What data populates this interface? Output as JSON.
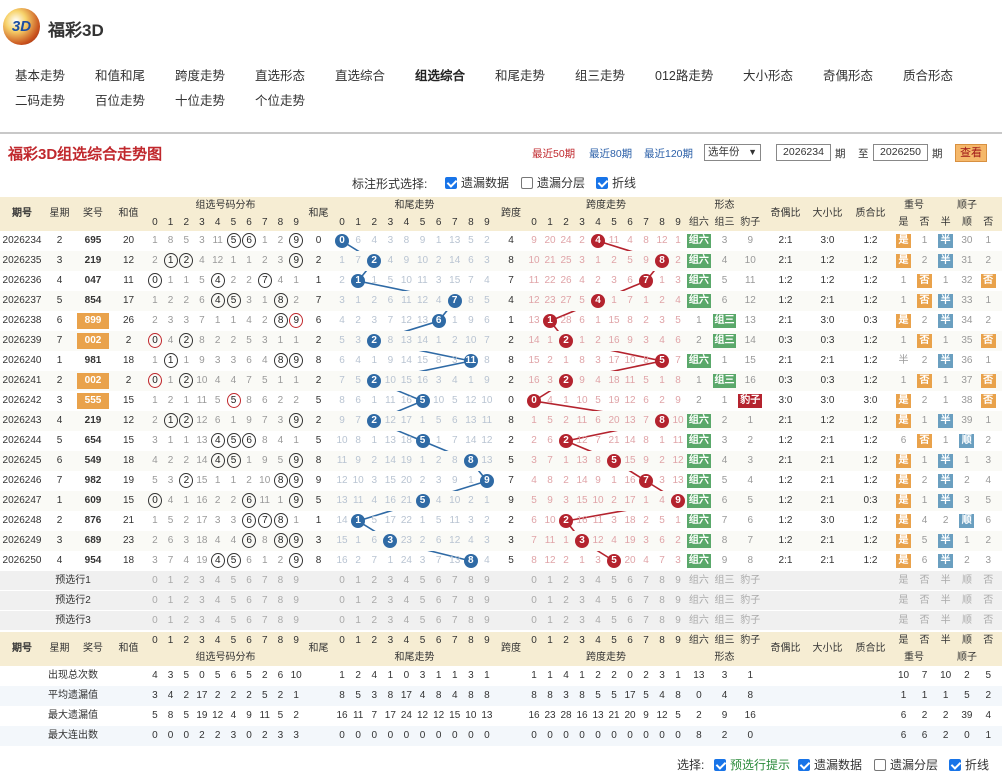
{
  "header": {
    "logo_text": "3D",
    "site_title": "福彩3D"
  },
  "nav": [
    "基本走势",
    "和值和尾",
    "跨度走势",
    "直选形态",
    "直选综合",
    "组选综合",
    "和尾走势",
    "组三走势",
    "012路走势",
    "大小形态",
    "奇偶形态",
    "质合形态",
    "二码走势",
    "百位走势",
    "十位走势",
    "个位走势"
  ],
  "nav_active": 5,
  "toolbar": {
    "title": "福彩3D组选综合走势图",
    "ranges": [
      "最近50期",
      "最近80期",
      "最近120期"
    ],
    "range_active": 0,
    "year_select": "选年份",
    "from": "2026234",
    "lbl_qi": "期",
    "lbl_to": "至",
    "to": "2026250",
    "view": "查看"
  },
  "mode": {
    "label": "标注形式选择:",
    "options": [
      {
        "label": "遗漏数据",
        "on": true
      },
      {
        "label": "遗漏分层",
        "on": false
      },
      {
        "label": "折线",
        "on": true
      }
    ]
  },
  "headers": {
    "issue": "期号",
    "week": "星期",
    "prize": "奖号",
    "sum": "和值",
    "dist": "组选号码分布",
    "tail": "和尾",
    "tail_trend": "和尾走势",
    "span": "跨度",
    "span_trend": "跨度走势",
    "form": "形态",
    "form_sub": [
      "组六",
      "组三",
      "豹子"
    ],
    "oe": "奇偶比",
    "bs": "大小比",
    "pc": "质合比",
    "dup": "重号",
    "dup_sub": [
      "是",
      "否"
    ],
    "seq": "顺子",
    "seq_sub": [
      "半",
      "顺",
      "否"
    ]
  },
  "rows": [
    {
      "issue": "2026234",
      "week": "2",
      "prize": "695",
      "sum": "20",
      "dist": [
        "1",
        "8",
        "5",
        "3",
        "11",
        "5",
        "6",
        "1",
        "2",
        "9"
      ],
      "tail": "0",
      "tt": [
        "0",
        "6",
        "4",
        "3",
        "8",
        "9",
        "1",
        "13",
        "5",
        "2"
      ],
      "span": "4",
      "st": [
        "9",
        "20",
        "24",
        "2",
        "4",
        "11",
        "4",
        "8",
        "12",
        "1"
      ],
      "form": [
        "组六",
        "3",
        "9"
      ],
      "oe": "2:1",
      "bs": "3:0",
      "pc": "1:2",
      "dup": [
        "是",
        "1"
      ],
      "seq": [
        "半",
        "30",
        "1"
      ]
    },
    {
      "issue": "2026235",
      "week": "3",
      "prize": "219",
      "sum": "12",
      "dist": [
        "2",
        "1",
        "2",
        "4",
        "12",
        "1",
        "1",
        "2",
        "3",
        "9"
      ],
      "tail": "2",
      "tt": [
        "1",
        "7",
        "2",
        "4",
        "9",
        "10",
        "2",
        "14",
        "6",
        "3"
      ],
      "span": "8",
      "st": [
        "10",
        "21",
        "25",
        "3",
        "1",
        "2",
        "5",
        "9",
        "8",
        "2"
      ],
      "form": [
        "组六",
        "4",
        "10"
      ],
      "oe": "2:1",
      "bs": "1:2",
      "pc": "1:2",
      "dup": [
        "是",
        "2"
      ],
      "seq": [
        "半",
        "31",
        "2"
      ]
    },
    {
      "issue": "2026236",
      "week": "4",
      "prize": "047",
      "sum": "11",
      "dist": [
        "0",
        "1",
        "1",
        "5",
        "4",
        "2",
        "2",
        "7",
        "4",
        "1"
      ],
      "tail": "1",
      "tt": [
        "2",
        "1",
        "1",
        "5",
        "10",
        "11",
        "3",
        "15",
        "7",
        "4"
      ],
      "span": "7",
      "st": [
        "11",
        "22",
        "26",
        "4",
        "2",
        "3",
        "6",
        "7",
        "1",
        "3"
      ],
      "form": [
        "组六",
        "5",
        "11"
      ],
      "oe": "1:2",
      "bs": "1:2",
      "pc": "1:2",
      "dup": [
        "1",
        "否"
      ],
      "seq": [
        "1",
        "32",
        "否"
      ]
    },
    {
      "issue": "2026237",
      "week": "5",
      "prize": "854",
      "sum": "17",
      "dist": [
        "1",
        "2",
        "2",
        "6",
        "4",
        "5",
        "3",
        "1",
        "8",
        "2"
      ],
      "tail": "7",
      "tt": [
        "3",
        "1",
        "2",
        "6",
        "11",
        "12",
        "4",
        "7",
        "8",
        "5"
      ],
      "span": "4",
      "st": [
        "12",
        "23",
        "27",
        "5",
        "4",
        "1",
        "7",
        "1",
        "2",
        "4"
      ],
      "form": [
        "组六",
        "6",
        "12"
      ],
      "oe": "1:2",
      "bs": "2:1",
      "pc": "1:2",
      "dup": [
        "1",
        "否"
      ],
      "seq": [
        "半",
        "33",
        "1"
      ]
    },
    {
      "issue": "2026238",
      "week": "6",
      "prize": "899",
      "sum": "26",
      "dist": [
        "2",
        "3",
        "3",
        "7",
        "1",
        "1",
        "4",
        "2",
        "8",
        "9"
      ],
      "tail": "6",
      "tt": [
        "4",
        "2",
        "3",
        "7",
        "12",
        "13",
        "6",
        "1",
        "9",
        "6"
      ],
      "span": "1",
      "st": [
        "13",
        "1",
        "28",
        "6",
        "1",
        "15",
        "8",
        "2",
        "3",
        "5"
      ],
      "form": [
        "1",
        "组三",
        "13"
      ],
      "oe": "2:1",
      "bs": "3:0",
      "pc": "0:3",
      "dup": [
        "是",
        "2"
      ],
      "seq": [
        "半",
        "34",
        "2"
      ]
    },
    {
      "issue": "2026239",
      "week": "7",
      "prize": "002",
      "sum": "2",
      "dist": [
        "0",
        "4",
        "2",
        "8",
        "2",
        "2",
        "5",
        "3",
        "1",
        "1"
      ],
      "tail": "2",
      "tt": [
        "5",
        "3",
        "2",
        "8",
        "13",
        "14",
        "1",
        "2",
        "10",
        "7"
      ],
      "span": "2",
      "st": [
        "14",
        "1",
        "2",
        "1",
        "2",
        "16",
        "9",
        "3",
        "4",
        "6"
      ],
      "form": [
        "2",
        "组三",
        "14"
      ],
      "oe": "0:3",
      "bs": "0:3",
      "pc": "1:2",
      "dup": [
        "1",
        "否"
      ],
      "seq": [
        "1",
        "35",
        "否"
      ]
    },
    {
      "issue": "2026240",
      "week": "1",
      "prize": "981",
      "sum": "18",
      "dist": [
        "1",
        "1",
        "1",
        "9",
        "3",
        "3",
        "6",
        "4",
        "8",
        "9"
      ],
      "tail": "8",
      "tt": [
        "6",
        "4",
        "1",
        "9",
        "14",
        "15",
        "8",
        "3",
        "11",
        "8"
      ],
      "span": "8",
      "st": [
        "15",
        "2",
        "1",
        "8",
        "3",
        "17",
        "10",
        "8",
        "5",
        "7"
      ],
      "form": [
        "组六",
        "1",
        "15"
      ],
      "oe": "2:1",
      "bs": "2:1",
      "pc": "1:2",
      "dup": [
        "半",
        "2"
      ],
      "seq": [
        "半",
        "36",
        "1"
      ]
    },
    {
      "issue": "2026241",
      "week": "2",
      "prize": "002",
      "sum": "2",
      "dist": [
        "0",
        "1",
        "2",
        "10",
        "4",
        "4",
        "7",
        "5",
        "1",
        "1"
      ],
      "tail": "2",
      "tt": [
        "7",
        "5",
        "2",
        "10",
        "15",
        "16",
        "3",
        "4",
        "1",
        "9"
      ],
      "span": "2",
      "st": [
        "16",
        "3",
        "2",
        "9",
        "4",
        "18",
        "11",
        "5",
        "1",
        "8"
      ],
      "form": [
        "1",
        "组三",
        "16"
      ],
      "oe": "0:3",
      "bs": "0:3",
      "pc": "1:2",
      "dup": [
        "1",
        "否"
      ],
      "seq": [
        "1",
        "37",
        "否"
      ]
    },
    {
      "issue": "2026242",
      "week": "3",
      "prize": "555",
      "sum": "15",
      "dist": [
        "1",
        "2",
        "1",
        "11",
        "5",
        "5",
        "8",
        "6",
        "2",
        "2"
      ],
      "tail": "5",
      "tt": [
        "8",
        "6",
        "1",
        "11",
        "16",
        "5",
        "10",
        "5",
        "12",
        "10"
      ],
      "span": "0",
      "st": [
        "0",
        "4",
        "1",
        "10",
        "5",
        "19",
        "12",
        "6",
        "2",
        "9"
      ],
      "form": [
        "2",
        "1",
        "豹子"
      ],
      "oe": "3:0",
      "bs": "3:0",
      "pc": "3:0",
      "dup": [
        "是",
        "2"
      ],
      "seq": [
        "1",
        "38",
        "否"
      ]
    },
    {
      "issue": "2026243",
      "week": "4",
      "prize": "219",
      "sum": "12",
      "dist": [
        "2",
        "1",
        "2",
        "12",
        "6",
        "1",
        "9",
        "7",
        "3",
        "9"
      ],
      "tail": "2",
      "tt": [
        "9",
        "7",
        "2",
        "12",
        "17",
        "1",
        "5",
        "6",
        "13",
        "11"
      ],
      "span": "8",
      "st": [
        "1",
        "5",
        "2",
        "11",
        "6",
        "20",
        "13",
        "7",
        "8",
        "10"
      ],
      "form": [
        "组六",
        "2",
        "1"
      ],
      "oe": "2:1",
      "bs": "1:2",
      "pc": "1:2",
      "dup": [
        "是",
        "1"
      ],
      "seq": [
        "半",
        "39",
        "1"
      ]
    },
    {
      "issue": "2026244",
      "week": "5",
      "prize": "654",
      "sum": "15",
      "dist": [
        "3",
        "1",
        "1",
        "13",
        "4",
        "5",
        "6",
        "8",
        "4",
        "1"
      ],
      "tail": "5",
      "tt": [
        "10",
        "8",
        "1",
        "13",
        "18",
        "5",
        "1",
        "7",
        "14",
        "12"
      ],
      "span": "2",
      "st": [
        "2",
        "6",
        "2",
        "12",
        "7",
        "21",
        "14",
        "8",
        "1",
        "11"
      ],
      "form": [
        "组六",
        "3",
        "2"
      ],
      "oe": "1:2",
      "bs": "2:1",
      "pc": "1:2",
      "dup": [
        "6",
        "否"
      ],
      "seq": [
        "1",
        "顺",
        "2"
      ]
    },
    {
      "issue": "2026245",
      "week": "6",
      "prize": "549",
      "sum": "18",
      "dist": [
        "4",
        "2",
        "2",
        "14",
        "4",
        "5",
        "1",
        "9",
        "5",
        "9"
      ],
      "tail": "8",
      "tt": [
        "11",
        "9",
        "2",
        "14",
        "19",
        "1",
        "2",
        "8",
        "8",
        "13"
      ],
      "span": "5",
      "st": [
        "3",
        "7",
        "1",
        "13",
        "8",
        "5",
        "15",
        "9",
        "2",
        "12"
      ],
      "form": [
        "组六",
        "4",
        "3"
      ],
      "oe": "2:1",
      "bs": "2:1",
      "pc": "1:2",
      "dup": [
        "是",
        "1"
      ],
      "seq": [
        "半",
        "1",
        "3"
      ]
    },
    {
      "issue": "2026246",
      "week": "7",
      "prize": "982",
      "sum": "19",
      "dist": [
        "5",
        "3",
        "2",
        "15",
        "1",
        "1",
        "2",
        "10",
        "8",
        "9"
      ],
      "tail": "9",
      "tt": [
        "12",
        "10",
        "3",
        "15",
        "20",
        "2",
        "3",
        "9",
        "1",
        "9"
      ],
      "span": "7",
      "st": [
        "4",
        "8",
        "2",
        "14",
        "9",
        "1",
        "16",
        "7",
        "3",
        "13"
      ],
      "form": [
        "组六",
        "5",
        "4"
      ],
      "oe": "1:2",
      "bs": "2:1",
      "pc": "1:2",
      "dup": [
        "是",
        "2"
      ],
      "seq": [
        "半",
        "2",
        "4"
      ]
    },
    {
      "issue": "2026247",
      "week": "1",
      "prize": "609",
      "sum": "15",
      "dist": [
        "0",
        "4",
        "1",
        "16",
        "2",
        "2",
        "6",
        "11",
        "1",
        "9"
      ],
      "tail": "5",
      "tt": [
        "13",
        "11",
        "4",
        "16",
        "21",
        "5",
        "4",
        "10",
        "2",
        "1"
      ],
      "span": "9",
      "st": [
        "5",
        "9",
        "3",
        "15",
        "10",
        "2",
        "17",
        "1",
        "4",
        "9"
      ],
      "form": [
        "组六",
        "6",
        "5"
      ],
      "oe": "1:2",
      "bs": "2:1",
      "pc": "0:3",
      "dup": [
        "是",
        "1"
      ],
      "seq": [
        "半",
        "3",
        "5"
      ]
    },
    {
      "issue": "2026248",
      "week": "2",
      "prize": "876",
      "sum": "21",
      "dist": [
        "1",
        "5",
        "2",
        "17",
        "3",
        "3",
        "6",
        "7",
        "8",
        "1"
      ],
      "tail": "1",
      "tt": [
        "14",
        "1",
        "5",
        "17",
        "22",
        "1",
        "5",
        "11",
        "3",
        "2"
      ],
      "span": "2",
      "st": [
        "6",
        "10",
        "2",
        "16",
        "11",
        "3",
        "18",
        "2",
        "5",
        "1"
      ],
      "form": [
        "组六",
        "7",
        "6"
      ],
      "oe": "1:2",
      "bs": "3:0",
      "pc": "1:2",
      "dup": [
        "是",
        "4"
      ],
      "seq": [
        "2",
        "顺",
        "6"
      ]
    },
    {
      "issue": "2026249",
      "week": "3",
      "prize": "689",
      "sum": "23",
      "dist": [
        "2",
        "6",
        "3",
        "18",
        "4",
        "4",
        "6",
        "8",
        "8",
        "9"
      ],
      "tail": "3",
      "tt": [
        "15",
        "1",
        "6",
        "3",
        "23",
        "2",
        "6",
        "12",
        "4",
        "3"
      ],
      "span": "3",
      "st": [
        "7",
        "11",
        "1",
        "3",
        "12",
        "4",
        "19",
        "3",
        "6",
        "2"
      ],
      "form": [
        "组六",
        "8",
        "7"
      ],
      "oe": "1:2",
      "bs": "2:1",
      "pc": "1:2",
      "dup": [
        "是",
        "5"
      ],
      "seq": [
        "半",
        "1",
        "2"
      ]
    },
    {
      "issue": "2026250",
      "week": "4",
      "prize": "954",
      "sum": "18",
      "dist": [
        "3",
        "7",
        "4",
        "19",
        "4",
        "5",
        "6",
        "1",
        "2",
        "9"
      ],
      "tail": "8",
      "tt": [
        "16",
        "2",
        "7",
        "1",
        "24",
        "3",
        "7",
        "13",
        "8",
        "4"
      ],
      "span": "5",
      "st": [
        "8",
        "12",
        "2",
        "1",
        "3",
        "5",
        "20",
        "4",
        "7",
        "3"
      ],
      "form": [
        "组六",
        "9",
        "8"
      ],
      "oe": "2:1",
      "bs": "2:1",
      "pc": "1:2",
      "dup": [
        "是",
        "6"
      ],
      "seq": [
        "半",
        "2",
        "3"
      ]
    }
  ],
  "preselect": [
    "预选行1",
    "预选行2",
    "预选行3"
  ],
  "digits": [
    "0",
    "1",
    "2",
    "3",
    "4",
    "5",
    "6",
    "7",
    "8",
    "9"
  ],
  "stats": [
    {
      "label": "出现总次数",
      "dist": [
        "4",
        "3",
        "5",
        "0",
        "5",
        "6",
        "5",
        "2",
        "6",
        "10"
      ],
      "tt": [
        "1",
        "2",
        "4",
        "1",
        "0",
        "3",
        "1",
        "1",
        "3",
        "1"
      ],
      "st": [
        "1",
        "1",
        "4",
        "1",
        "2",
        "2",
        "0",
        "2",
        "3",
        "1"
      ],
      "form": [
        "13",
        "3",
        "1"
      ],
      "dup": [
        "10",
        "7"
      ],
      "seq": [
        "10",
        "2",
        "5"
      ]
    },
    {
      "label": "平均遗漏值",
      "dist": [
        "3",
        "4",
        "2",
        "17",
        "2",
        "2",
        "2",
        "5",
        "2",
        "1"
      ],
      "tt": [
        "8",
        "5",
        "3",
        "8",
        "17",
        "4",
        "8",
        "4",
        "8",
        "8"
      ],
      "st": [
        "8",
        "8",
        "3",
        "8",
        "5",
        "5",
        "17",
        "5",
        "4",
        "8"
      ],
      "form": [
        "0",
        "4",
        "8"
      ],
      "dup": [
        "1",
        "1"
      ],
      "seq": [
        "1",
        "5",
        "2"
      ]
    },
    {
      "label": "最大遗漏值",
      "dist": [
        "5",
        "8",
        "5",
        "19",
        "12",
        "4",
        "9",
        "11",
        "5",
        "2"
      ],
      "tt": [
        "16",
        "11",
        "7",
        "17",
        "24",
        "12",
        "12",
        "15",
        "10",
        "13"
      ],
      "st": [
        "16",
        "23",
        "28",
        "16",
        "13",
        "21",
        "20",
        "9",
        "12",
        "5"
      ],
      "form": [
        "2",
        "9",
        "16"
      ],
      "dup": [
        "6",
        "2"
      ],
      "seq": [
        "2",
        "39",
        "4"
      ]
    },
    {
      "label": "最大连出数",
      "dist": [
        "0",
        "0",
        "0",
        "2",
        "2",
        "3",
        "0",
        "2",
        "3",
        "3"
      ],
      "tt": [
        "0",
        "0",
        "0",
        "0",
        "0",
        "0",
        "0",
        "0",
        "0",
        "0"
      ],
      "st": [
        "0",
        "0",
        "0",
        "0",
        "0",
        "0",
        "0",
        "0",
        "0",
        "0"
      ],
      "form": [
        "8",
        "2",
        "0"
      ],
      "dup": [
        "6",
        "6"
      ],
      "seq": [
        "2",
        "0",
        "1"
      ]
    }
  ],
  "bottom": {
    "label": "选择:",
    "options": [
      {
        "label": "预选行提示",
        "on": true
      },
      {
        "label": "遗漏数据",
        "on": true
      },
      {
        "label": "遗漏分层",
        "on": false
      },
      {
        "label": "折线",
        "on": true
      }
    ]
  },
  "colors": {
    "header_bg": "#f6edd3",
    "blue_ball": "#2f6aa5",
    "red_ball": "#b4232e",
    "orange": "#e9a24b",
    "green": "#5aa86a"
  }
}
